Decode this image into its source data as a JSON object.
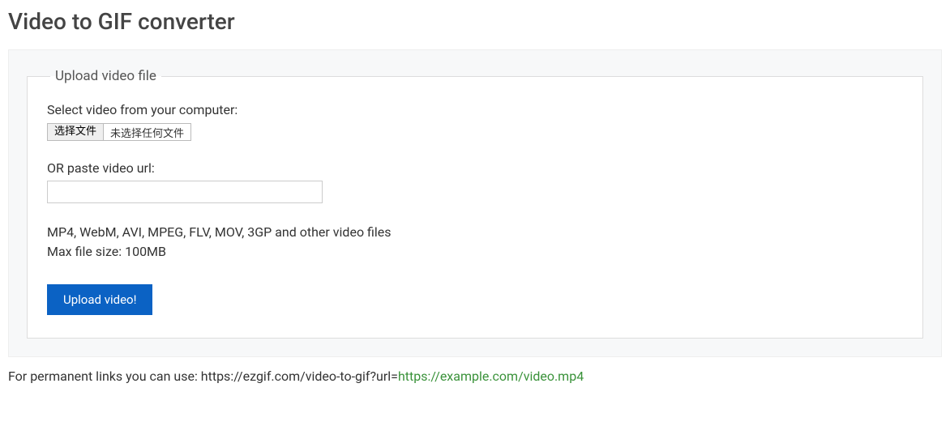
{
  "page_title": "Video to GIF converter",
  "upload_panel": {
    "legend": "Upload video file",
    "select_label": "Select video from your computer:",
    "file_button_label": "选择文件",
    "file_status_text": "未选择任何文件",
    "url_label": "OR paste video url:",
    "url_value": "",
    "formats_note": "MP4, WebM, AVI, MPEG, FLV, MOV, 3GP and other video files",
    "max_size_note": "Max file size: 100MB",
    "upload_button_label": "Upload video!"
  },
  "permalink": {
    "prefix": "For permanent links you can use: https://ezgif.com/video-to-gif?url=",
    "example": "https://example.com/video.mp4"
  }
}
